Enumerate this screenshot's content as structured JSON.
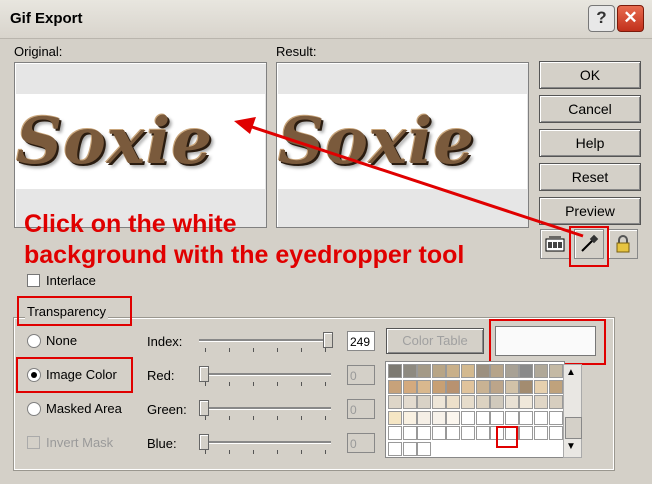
{
  "window": {
    "title": "Gif Export",
    "help_label": "?",
    "close_label": "✕"
  },
  "labels": {
    "original": "Original:",
    "result": "Result:"
  },
  "preview": {
    "text": "Soxie"
  },
  "buttons": {
    "ok": "OK",
    "cancel": "Cancel",
    "help": "Help",
    "reset": "Reset",
    "preview": "Preview"
  },
  "icons": {
    "preview_toggle": "thumbnail-icon",
    "eyedropper": "eyedropper-icon",
    "lock": "lock-icon"
  },
  "annotation": {
    "line1": "Click on the white",
    "line2": "background with the eyedropper tool"
  },
  "interlace": {
    "label": "Interlace",
    "checked": false
  },
  "transparency": {
    "title": "Transparency",
    "options": [
      {
        "label": "None",
        "selected": false,
        "enabled": true
      },
      {
        "label": "Image Color",
        "selected": true,
        "enabled": true
      },
      {
        "label": "Masked Area",
        "selected": false,
        "enabled": true
      }
    ],
    "invert_mask": {
      "label": "Invert Mask",
      "enabled": false
    },
    "index": {
      "label": "Index:",
      "value": "249",
      "level": 1.0
    },
    "red": {
      "label": "Red:",
      "value": "0",
      "level": 0
    },
    "green": {
      "label": "Green:",
      "value": "0",
      "level": 0
    },
    "blue": {
      "label": "Blue:",
      "value": "0",
      "level": 0
    },
    "color_table_label": "Color Table",
    "selected_color": "#fafafa"
  },
  "palette": [
    "#7d7a72",
    "#8e8a80",
    "#a49a87",
    "#b8a586",
    "#c9b08a",
    "#d3b98f",
    "#9c9080",
    "#b6a48a",
    "#a8a195",
    "#8a8a8a",
    "#b0a898",
    "#c4b9a4",
    "#c7a27a",
    "#d4aa7e",
    "#d9b88e",
    "#c8a074",
    "#b89270",
    "#e0c39c",
    "#c9b293",
    "#bca58a",
    "#d2c2a8",
    "#a38c70",
    "#e6d0ae",
    "#bfa27c",
    "#ded6c8",
    "#e3dbcf",
    "#d9d2c6",
    "#eee6d8",
    "#ede0ca",
    "#e6dccb",
    "#dcd2c1",
    "#d0c9bc",
    "#e9e1d4",
    "#f0e8da",
    "#e0d6c6",
    "#d7cebf",
    "#f5e6c4",
    "#f9f1e2",
    "#f5efe6",
    "#f7f2ea",
    "#fbf6ee",
    "#ffffff",
    "#ffffff",
    "#ffffff",
    "#ffffff",
    "#ffffff",
    "#ffffff",
    "#ffffff",
    "#ffffff",
    "#ffffff",
    "#ffffff",
    "#ffffff",
    "#ffffff",
    "#ffffff",
    "#ffffff",
    "#ffffff",
    "#ffffff",
    "#ffffff",
    "#ffffff",
    "#ffffff",
    "#ffffff",
    "#ffffff",
    "#ffffff"
  ],
  "colors": {
    "annotation": "#e00000",
    "dialog_bg": "#d4d0c8"
  }
}
